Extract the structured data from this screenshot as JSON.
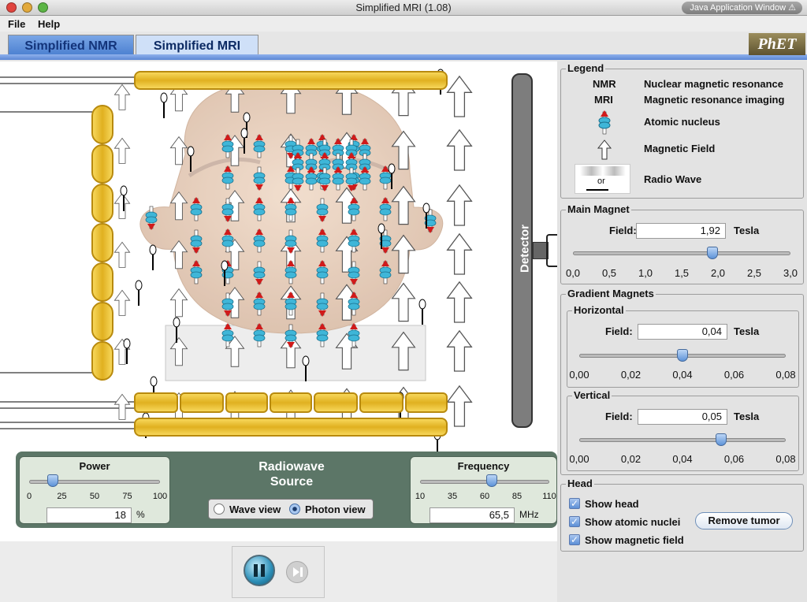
{
  "window": {
    "title": "Simplified MRI (1.08)",
    "badge": "Java Application Window"
  },
  "menu": {
    "file": "File",
    "help": "Help"
  },
  "tabs": [
    {
      "label": "Simplified NMR"
    },
    {
      "label": "Simplified MRI"
    }
  ],
  "logo": "PhET",
  "detector": {
    "label": "Detector"
  },
  "legend": {
    "title": "Legend",
    "rows": [
      {
        "abbr": "NMR",
        "text": "Nuclear magnetic resonance"
      },
      {
        "abbr": "MRI",
        "text": "Magnetic resonance imaging"
      },
      {
        "text": "Atomic nucleus"
      },
      {
        "text": "Magnetic Field"
      },
      {
        "text": "Radio Wave"
      }
    ],
    "or": "or"
  },
  "main_magnet": {
    "title": "Main Magnet",
    "field_label": "Field:",
    "value": "1,92",
    "unit": "Tesla",
    "ticks": [
      "0,0",
      "0,5",
      "1,0",
      "1,5",
      "2,0",
      "2,5",
      "3,0"
    ],
    "level": 1.92,
    "min": 0,
    "max": 3
  },
  "gradient": {
    "title": "Gradient Magnets",
    "horizontal": {
      "title": "Horizontal",
      "field_label": "Field:",
      "value": "0,04",
      "unit": "Tesla",
      "ticks": [
        "0,00",
        "0,02",
        "0,04",
        "0,06",
        "0,08"
      ],
      "level": 0.04,
      "min": 0,
      "max": 0.08
    },
    "vertical": {
      "title": "Vertical",
      "field_label": "Field:",
      "value": "0,05",
      "unit": "Tesla",
      "ticks": [
        "0,00",
        "0,02",
        "0,04",
        "0,06",
        "0,08"
      ],
      "level": 0.055,
      "min": 0,
      "max": 0.08
    }
  },
  "head_panel": {
    "title": "Head",
    "show_head": "Show head",
    "show_nuclei": "Show atomic nuclei",
    "show_field": "Show magnetic field",
    "remove_tumor": "Remove tumor"
  },
  "radiowave": {
    "title_line1": "Radiowave",
    "title_line2": "Source",
    "wave_view": "Wave view",
    "photon_view": "Photon view",
    "power": {
      "label": "Power",
      "value": "18",
      "unit": "%",
      "ticks": [
        "0",
        "25",
        "50",
        "75",
        "100"
      ],
      "level": 18,
      "min": 0,
      "max": 100
    },
    "frequency": {
      "label": "Frequency",
      "value": "65,5",
      "unit": "MHz",
      "ticks": [
        "10",
        "35",
        "60",
        "85",
        "110"
      ],
      "level": 65.5,
      "min": 10,
      "max": 110
    }
  },
  "colors": {
    "tab_active": "#4a7fd0",
    "coil": "#e0b020",
    "panel_green": "#5c7667",
    "nucleus_red": "#d01a1a",
    "nucleus_cyan": "#3fb6d8"
  }
}
